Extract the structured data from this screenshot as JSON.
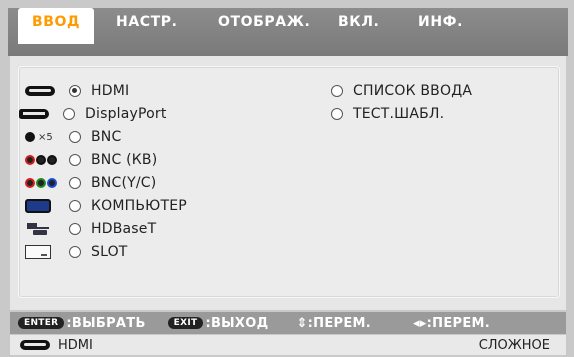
{
  "tabs": [
    {
      "label": "ВВОД",
      "active": true
    },
    {
      "label": "НАСТР.",
      "active": false
    },
    {
      "label": "ОТОБРАЖ.",
      "active": false
    },
    {
      "label": "ВКЛ.",
      "active": false
    },
    {
      "label": "ИНФ.",
      "active": false
    }
  ],
  "inputs_left": [
    {
      "label": "HDMI",
      "icon": "hdmi-icon",
      "selected": true
    },
    {
      "label": "DisplayPort",
      "icon": "displayport-icon",
      "selected": false
    },
    {
      "label": "BNC",
      "icon": "bnc-icon",
      "icon_text": "×5",
      "selected": false
    },
    {
      "label": "BNC (КВ)",
      "icon": "bnc-component-icon",
      "selected": false
    },
    {
      "label": "BNC(Y/C)",
      "icon": "bnc-yc-icon",
      "selected": false
    },
    {
      "label": "КОМПЬЮТЕР",
      "icon": "computer-icon",
      "selected": false
    },
    {
      "label": "HDBaseT",
      "icon": "hdbaset-icon",
      "selected": false
    },
    {
      "label": "SLOT",
      "icon": "slot-icon",
      "selected": false
    }
  ],
  "inputs_right": [
    {
      "label": "СПИСОК ВВОДА",
      "selected": false
    },
    {
      "label": "ТЕСТ.ШАБЛ.",
      "selected": false
    }
  ],
  "help": {
    "enter_key": "ENTER",
    "enter_label": ":ВЫБРАТЬ",
    "exit_key": "EXIT",
    "exit_label": ":ВЫХОД",
    "updown_label": "⇕:ПЕРЕМ.",
    "leftright_label": "◂▸:ПЕРЕМ."
  },
  "status": {
    "current_input": "HDMI",
    "mode": "СЛОЖНОЕ"
  },
  "colors": {
    "active_tab_text": "#ff9a00",
    "bnc_red": "#d81c1c",
    "bnc_green": "#1d8a1d",
    "bnc_blue": "#1c4bd8",
    "computer_blue": "#1e3a8a"
  }
}
